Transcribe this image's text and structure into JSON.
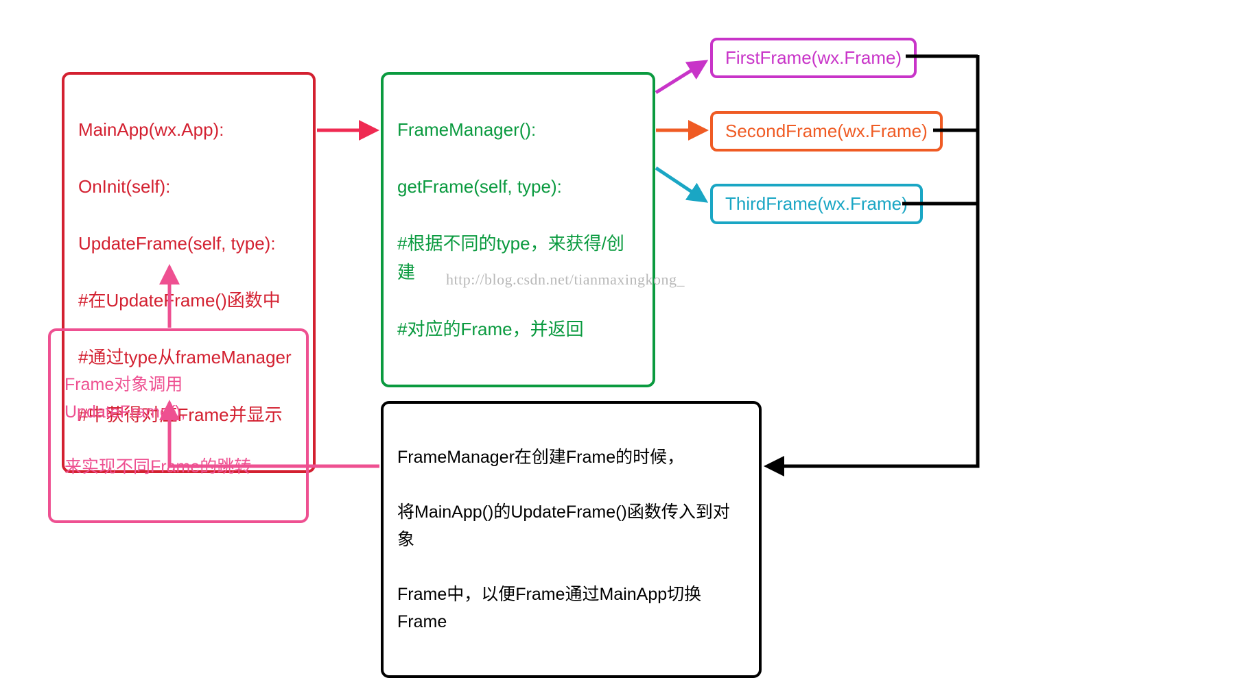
{
  "mainApp": {
    "title": "MainApp(wx.App):",
    "line1": "  OnInit(self):",
    "line2": "  UpdateFrame(self, type):",
    "line3": "  #在UpdateFrame()函数中",
    "line4": "  #通过type从frameManager",
    "line5": "  #中获得对应Frame并显示"
  },
  "frameManager": {
    "title": "FrameManager():",
    "line1": "    getFrame(self, type):",
    "line2": "    #根据不同的type，来获得/创建",
    "line3": "    #对应的Frame，并返回"
  },
  "firstFrame": "FirstFrame(wx.Frame)",
  "secondFrame": "SecondFrame(wx.Frame)",
  "thirdFrame": "ThirdFrame(wx.Frame)",
  "updateNote": {
    "line1": "Frame对象调用UpdateFrame(),",
    "line2": "来实现不同Frame的跳转"
  },
  "managerNote": {
    "line1": "FrameManager在创建Frame的时候，",
    "line2": "将MainApp()的UpdateFrame()函数传入到对象",
    "line3": "Frame中，以便Frame通过MainApp切换Frame"
  },
  "watermark": "http://blog.csdn.net/tianmaxingkong_",
  "colors": {
    "red": "#d32030",
    "redArrow": "#ef2a52",
    "green": "#0a9a3f",
    "magenta": "#c834c8",
    "orange": "#ef5b24",
    "cyan": "#1aa6c4",
    "pink": "#ee5091",
    "black": "#000000"
  }
}
